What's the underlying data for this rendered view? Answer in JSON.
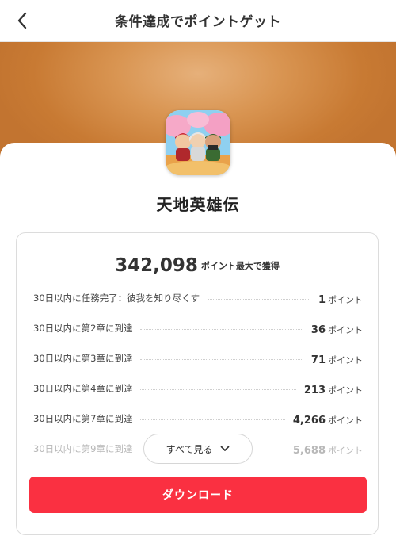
{
  "header": {
    "title": "条件達成でポイントゲット",
    "back_icon": "chevron-left-icon"
  },
  "app": {
    "name": "天地英雄伝",
    "icon": "game-app-icon"
  },
  "summary": {
    "total_points": "342,098",
    "total_suffix": "ポイント最大で獲得"
  },
  "tasks": [
    {
      "label": "30日以内に任務完了：彼我を知り尽くす",
      "points": "1",
      "unit": "ポイント"
    },
    {
      "label": "30日以内に第2章に到達",
      "points": "36",
      "unit": "ポイント"
    },
    {
      "label": "30日以内に第3章に到達",
      "points": "71",
      "unit": "ポイント"
    },
    {
      "label": "30日以内に第4章に到達",
      "points": "213",
      "unit": "ポイント"
    },
    {
      "label": "30日以内に第7章に到達",
      "points": "4,266",
      "unit": "ポイント"
    },
    {
      "label": "30日以内に第9章に到達",
      "points": "5,688",
      "unit": "ポイント"
    }
  ],
  "see_all": {
    "label": "すべて見る",
    "icon": "chevron-down-icon"
  },
  "download_button": {
    "label": "ダウンロード"
  },
  "colors": {
    "accent": "#fa3041",
    "banner": "#d08540"
  }
}
